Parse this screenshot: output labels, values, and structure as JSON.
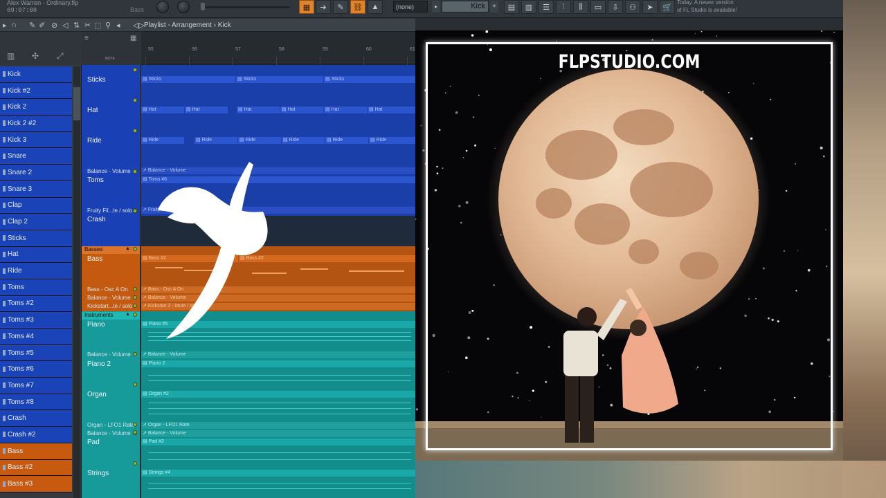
{
  "toolbar": {
    "project_name": "Alex Warren - Ordinary.flp",
    "song_time": "69:07:08",
    "bass_label": "Bass",
    "pattern_select": "(none)",
    "pattern_name": "Kick",
    "news_line1": "Today. A newer version",
    "news_line2": "of FL Studio is available!",
    "accent_color": "#e1832a"
  },
  "playlist": {
    "breadcrumb_part1": "Playlist",
    "breadcrumb_sep": " - ",
    "breadcrumb_part2": "Arrangement",
    "breadcrumb_sep2": " › ",
    "breadcrumb_part3": "Kick",
    "bars": [
      "55",
      "56",
      "57",
      "58",
      "59",
      "60",
      "61"
    ],
    "note_label": "NOTE"
  },
  "channels": [
    {
      "label": "Kick",
      "color": "#1a43b8"
    },
    {
      "label": "Kick #2",
      "color": "#1a43b8"
    },
    {
      "label": "Kick 2",
      "color": "#1a43b8"
    },
    {
      "label": "Kick 2 #2",
      "color": "#1a43b8"
    },
    {
      "label": "Kick 3",
      "color": "#1a43b8"
    },
    {
      "label": "Snare",
      "color": "#1a43b8"
    },
    {
      "label": "Snare 2",
      "color": "#1a43b8"
    },
    {
      "label": "Snare 3",
      "color": "#1a43b8"
    },
    {
      "label": "Clap",
      "color": "#1a43b8"
    },
    {
      "label": "Clap 2",
      "color": "#1a43b8"
    },
    {
      "label": "Sticks",
      "color": "#1a43b8"
    },
    {
      "label": "Hat",
      "color": "#1a43b8"
    },
    {
      "label": "Ride",
      "color": "#1a43b8"
    },
    {
      "label": "Toms",
      "color": "#1a43b8"
    },
    {
      "label": "Toms #2",
      "color": "#1a43b8"
    },
    {
      "label": "Toms #3",
      "color": "#1a43b8"
    },
    {
      "label": "Toms #4",
      "color": "#1a43b8"
    },
    {
      "label": "Toms #5",
      "color": "#1a43b8"
    },
    {
      "label": "Toms #6",
      "color": "#1a43b8"
    },
    {
      "label": "Toms #7",
      "color": "#1a43b8"
    },
    {
      "label": "Toms #8",
      "color": "#1a43b8"
    },
    {
      "label": "Crash",
      "color": "#1a43b8"
    },
    {
      "label": "Crash #2",
      "color": "#1a43b8"
    },
    {
      "label": "Bass",
      "color": "#c85a10"
    },
    {
      "label": "Bass #2",
      "color": "#c85a10"
    },
    {
      "label": "Bass #3",
      "color": "#c85a10"
    }
  ],
  "tracks": {
    "sticks": "Sticks",
    "hat": "Hat",
    "ride": "Ride",
    "balance_volume_1": "Balance - Volume",
    "toms": "Toms",
    "fruity_fil": "Fruity Fil...te / solo",
    "crash": "Crash",
    "basses_group": "Basses",
    "bass": "Bass",
    "bass_osc": "Bass - Osc A On",
    "balance_volume_2": "Balance - Volume",
    "kickstart": "Kickstart...te / solo",
    "instruments_group": "Instruments",
    "piano": "Piano",
    "balance_volume_3": "Balance - Volume",
    "piano2": "Piano 2",
    "organ": "Organ",
    "organ_lfo": "Organ - LFO1 Rate",
    "balance_volume_4": "Balance - Volume",
    "pad": "Pad",
    "strings": "Strings"
  },
  "clips": {
    "sticks": "Sticks",
    "hat": "Hat",
    "ride": "Ride",
    "balance_volume": "Balance - Volume",
    "toms6": "Toms #6",
    "fruity": "Fruity Fil",
    "bass2": "Bass #2",
    "bass_osc": "Bass - Osc A On",
    "balance_volume_b": "Balance - Volume",
    "kickstart": "Kickstart 2 - Mute / solo",
    "piano5": "Piano #5",
    "balance_volume_c": "Balance - Volume",
    "piano2": "Piano 2",
    "organ2": "Organ #2",
    "organ_lfo": "Organ - LFO1 Rate",
    "balance_volume_d": "Balance - Volume",
    "pad2": "Pad #2",
    "strings4": "Strings #4",
    "strings4b": "Strings #4"
  },
  "art": {
    "title": "FLPSTUDIO.COM"
  },
  "colors": {
    "drums": "#1a43b8",
    "basses": "#c85a10",
    "instruments": "#179a9a"
  }
}
